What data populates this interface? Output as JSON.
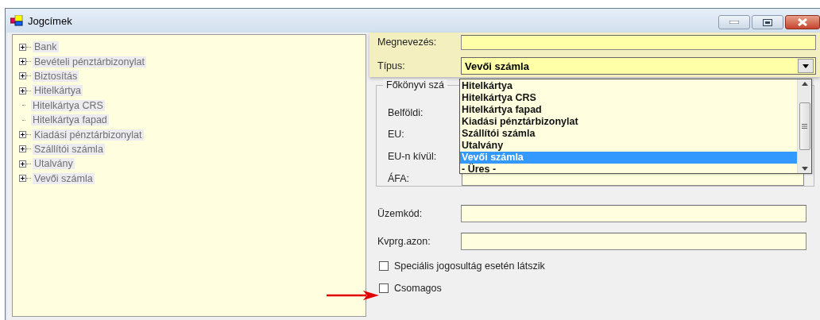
{
  "window": {
    "title": "Jogcímek"
  },
  "tree": [
    {
      "label": "Bank",
      "kind": "node"
    },
    {
      "label": "Bevételi pénztárbizonylat",
      "kind": "node"
    },
    {
      "label": "Biztosítás",
      "kind": "node"
    },
    {
      "label": "Hitelkártya",
      "kind": "node"
    },
    {
      "label": "Hitelkártya CRS",
      "kind": "leaf"
    },
    {
      "label": "Hitelkártya fapad",
      "kind": "leaf"
    },
    {
      "label": "Kiadási pénztárbizonylat",
      "kind": "node"
    },
    {
      "label": "Szállítói számla",
      "kind": "node"
    },
    {
      "label": "Utalvány",
      "kind": "node"
    },
    {
      "label": "Vevői számla",
      "kind": "node"
    }
  ],
  "name_field": {
    "label": "Megnevezés:"
  },
  "type_field": {
    "label": "Típus:",
    "value": "Vevői számla"
  },
  "type_dropdown": [
    {
      "label": "Hitelkártya",
      "selected": false
    },
    {
      "label": "Hitelkártya CRS",
      "selected": false
    },
    {
      "label": "Hitelkártya fapad",
      "selected": false
    },
    {
      "label": "Kiadási pénztárbizonylat",
      "selected": false
    },
    {
      "label": "Szállítói számla",
      "selected": false
    },
    {
      "label": "Utalvány",
      "selected": false
    },
    {
      "label": "Vevői számla",
      "selected": true
    },
    {
      "label": "- Üres -",
      "selected": false
    }
  ],
  "ledger_group": {
    "title": "Főkönyvi szá",
    "fields": [
      {
        "label": "Belföldi:"
      },
      {
        "label": "EU:"
      },
      {
        "label": "EU-n kívül:"
      },
      {
        "label": "ÁFA:"
      }
    ]
  },
  "fields": [
    {
      "label": "Üzemkód:"
    },
    {
      "label": "Kvprg.azon:"
    }
  ],
  "checkboxes": [
    {
      "label": "Speciális jogosultág esetén látszik",
      "checked": false
    },
    {
      "label": "Csomagos",
      "checked": false
    }
  ]
}
